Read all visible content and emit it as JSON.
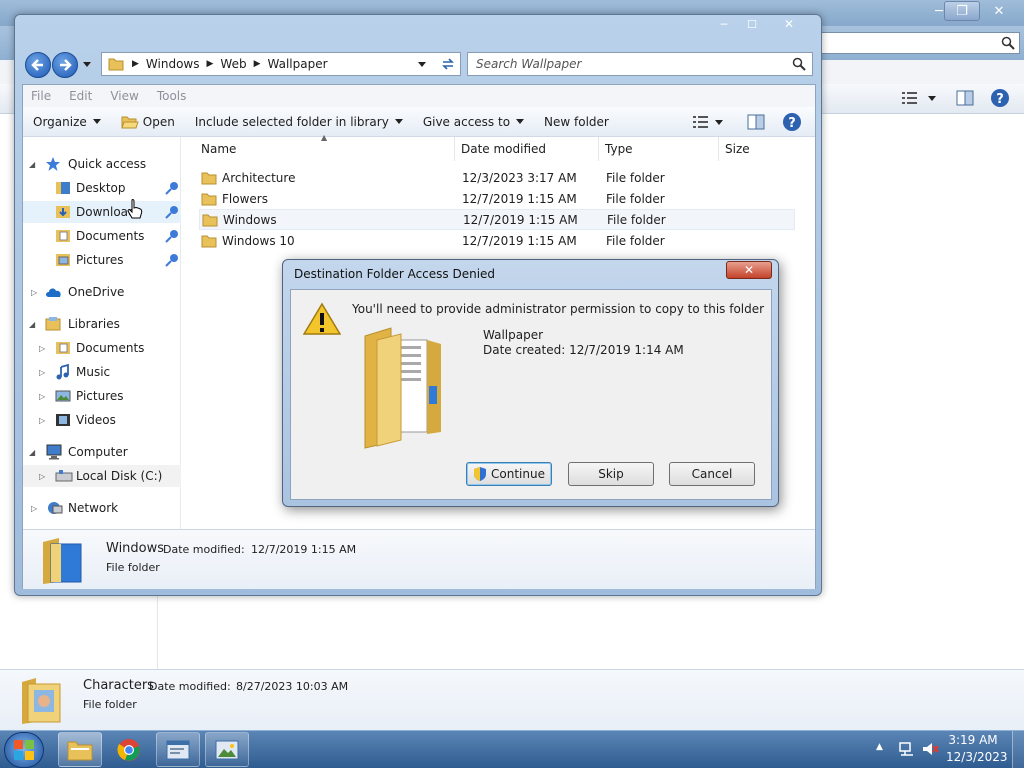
{
  "background_window": {
    "detail": {
      "name": "Characters",
      "date_label": "Date modified:",
      "date_value": "8/27/2023 10:03 AM",
      "type": "File folder"
    }
  },
  "explorer": {
    "breadcrumb": [
      "Windows",
      "Web",
      "Wallpaper"
    ],
    "search_placeholder": "Search Wallpaper",
    "menu": [
      "File",
      "Edit",
      "View",
      "Tools"
    ],
    "toolbar": {
      "organize": "Organize",
      "open": "Open",
      "include": "Include selected folder in library",
      "give_access": "Give access to",
      "new_folder": "New folder"
    },
    "nav": {
      "quick_access": "Quick access",
      "desktop": "Desktop",
      "downloads": "Downloads",
      "documents": "Documents",
      "pictures": "Pictures",
      "onedrive": "OneDrive",
      "libraries": "Libraries",
      "lib_documents": "Documents",
      "lib_music": "Music",
      "lib_pictures": "Pictures",
      "lib_videos": "Videos",
      "computer": "Computer",
      "local_disk": "Local Disk (C:)",
      "network": "Network"
    },
    "columns": {
      "name": "Name",
      "date": "Date modified",
      "type": "Type",
      "size": "Size"
    },
    "files": [
      {
        "name": "Architecture",
        "date": "12/3/2023 3:17 AM",
        "type": "File folder"
      },
      {
        "name": "Flowers",
        "date": "12/7/2019 1:15 AM",
        "type": "File folder"
      },
      {
        "name": "Windows",
        "date": "12/7/2019 1:15 AM",
        "type": "File folder"
      },
      {
        "name": "Windows 10",
        "date": "12/7/2019 1:15 AM",
        "type": "File folder"
      }
    ],
    "detail": {
      "name": "Windows",
      "date_label": "Date modified:",
      "date_value": "12/7/2019 1:15 AM",
      "type": "File folder"
    }
  },
  "dialog": {
    "title": "Destination Folder Access Denied",
    "message": "You'll need to provide administrator permission to copy to this folder",
    "folder_name": "Wallpaper",
    "date_created": "Date created: 12/7/2019 1:14 AM",
    "continue": "Continue",
    "skip": "Skip",
    "cancel": "Cancel"
  },
  "taskbar": {
    "time": "3:19 AM",
    "date": "12/3/2023"
  },
  "colors": {
    "accent": "#1f58b5",
    "taskbar": "#3a6aa0",
    "folder": "#e8c15a"
  }
}
